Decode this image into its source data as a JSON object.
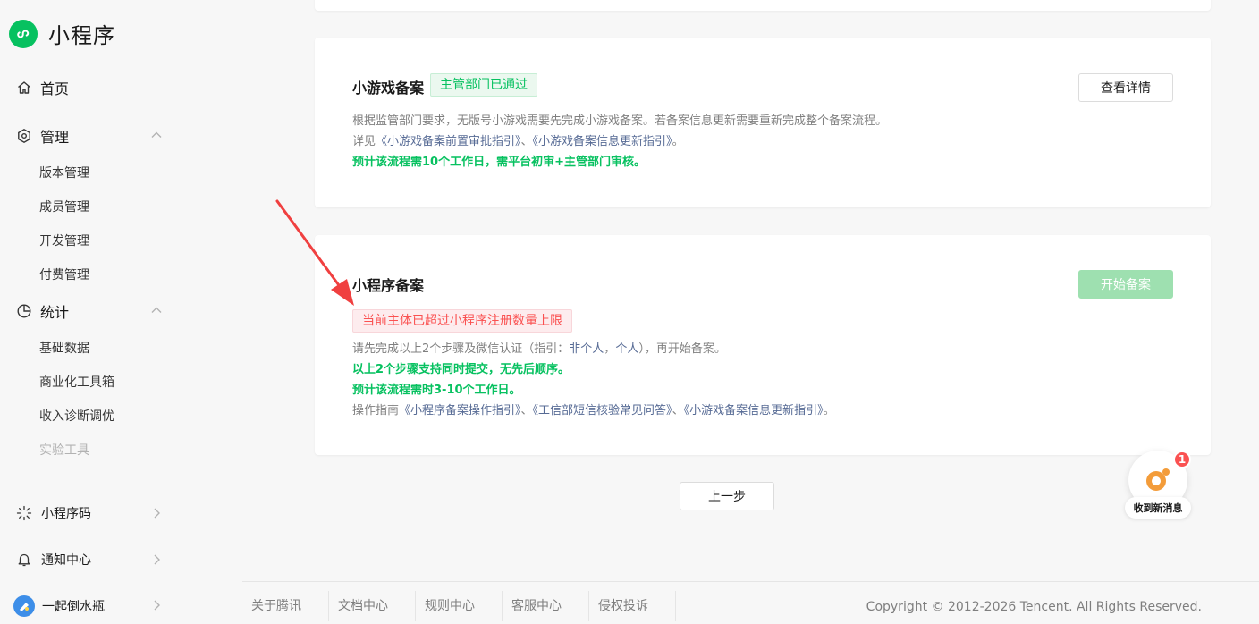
{
  "app": {
    "title": "小程序"
  },
  "sidebar": {
    "home": {
      "label": "首页"
    },
    "manage": {
      "label": "管理",
      "items": [
        "版本管理",
        "成员管理",
        "开发管理",
        "付费管理"
      ]
    },
    "stats": {
      "label": "统计",
      "items": [
        "基础数据",
        "商业化工具箱",
        "收入诊断调优",
        "实验工具"
      ]
    },
    "bottom": [
      {
        "label": "小程序码",
        "icon": "sparkle-icon"
      },
      {
        "label": "通知中心",
        "icon": "bell-icon"
      },
      {
        "label": "一起倒水瓶",
        "icon": "avatar"
      }
    ]
  },
  "game_card": {
    "title": "小游戏备案",
    "status_tag": "主管部门已通过",
    "details_button": "查看详情",
    "line1": "根据监管部门要求，无版号小游戏需要先完成小游戏备案。若备案信息更新需要重新完成整个备案流程。",
    "line2_prefix": "详见",
    "line2_link1": "《小游戏备案前置审批指引》",
    "line2_sep": "、",
    "line2_link2": "《小游戏备案信息更新指引》",
    "line2_suffix": "。",
    "line3": "预计该流程需10个工作日，需平台初审+主管部门审核。"
  },
  "mp_card": {
    "title": "小程序备案",
    "start_button": "开始备案",
    "error_tag": "当前主体已超过小程序注册数量上限",
    "line1_prefix": "请先完成以上2个步骤及微信认证（指引：",
    "line1_link1": "非个人",
    "line1_sep": "，",
    "line1_link2": "个人",
    "line1_suffix": "），再开始备案。",
    "line2": "以上2个步骤支持同时提交，无先后顺序。",
    "line3": "预计该流程需时3-10个工作日。",
    "line4_prefix": "操作指南",
    "line4_link1": "《小程序备案操作指引》",
    "line4_sep1": "、",
    "line4_link2": "《工信部短信核验常见问答》",
    "line4_sep2": "、",
    "line4_link3": "《小游戏备案信息更新指引》",
    "line4_suffix": "。"
  },
  "prev_button": "上一步",
  "message_widget": {
    "badge": "1",
    "label": "收到新消息"
  },
  "footer": {
    "links": [
      "关于腾讯",
      "文档中心",
      "规则中心",
      "客服中心",
      "侵权投诉"
    ],
    "copyright": "Copyright © 2012-2026 Tencent. All Rights Reserved."
  },
  "colors": {
    "brand": "#07c160",
    "danger": "#fa5151",
    "link": "#576b95",
    "annotation_arrow": "#f04040"
  }
}
